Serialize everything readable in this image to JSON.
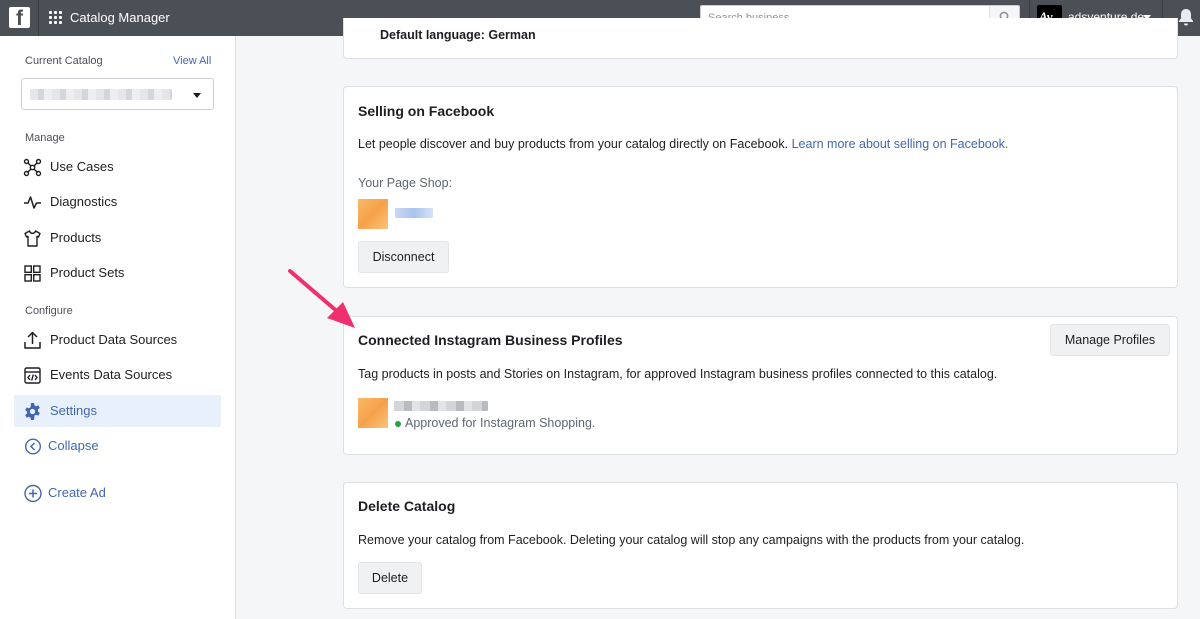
{
  "topbar": {
    "app_title": "Catalog Manager",
    "search_placeholder": "Search business",
    "account_name": "adsventure.de",
    "account_logo_text": "Av"
  },
  "sidebar": {
    "current_catalog_label": "Current Catalog",
    "view_all": "View All",
    "manage_label": "Manage",
    "configure_label": "Configure",
    "items": [
      {
        "label": "Use Cases",
        "icon": "use-cases-icon"
      },
      {
        "label": "Diagnostics",
        "icon": "pulse-icon"
      },
      {
        "label": "Products",
        "icon": "shirt-icon"
      },
      {
        "label": "Product Sets",
        "icon": "grid-squares-icon"
      },
      {
        "label": "Product Data Sources",
        "icon": "upload-icon"
      },
      {
        "label": "Events Data Sources",
        "icon": "code-window-icon"
      },
      {
        "label": "Settings",
        "icon": "gear-icon",
        "active": true
      }
    ],
    "collapse_label": "Collapse",
    "create_ad_label": "Create Ad"
  },
  "main": {
    "partial_card_text": "Default language: German",
    "selling": {
      "title": "Selling on Facebook",
      "description": "Let people discover and buy products from your catalog directly on Facebook.",
      "learn_more": "Learn more about selling on Facebook.",
      "page_shop_label": "Your Page Shop:",
      "disconnect_button": "Disconnect"
    },
    "instagram": {
      "title": "Connected Instagram Business Profiles",
      "manage_button": "Manage Profiles",
      "description": "Tag products in posts and Stories on Instagram, for approved Instagram business profiles connected to this catalog.",
      "status_text": "Approved for Instagram Shopping."
    },
    "delete": {
      "title": "Delete Catalog",
      "description": "Remove your catalog from Facebook. Deleting your catalog will stop any campaigns with the products from your catalog.",
      "delete_button": "Delete"
    }
  },
  "colors": {
    "topbar": "#4b4f56",
    "link": "#4267b2",
    "active_bg": "#e7f0fb",
    "arrow": "#f0306e",
    "status_green": "#24a148"
  }
}
